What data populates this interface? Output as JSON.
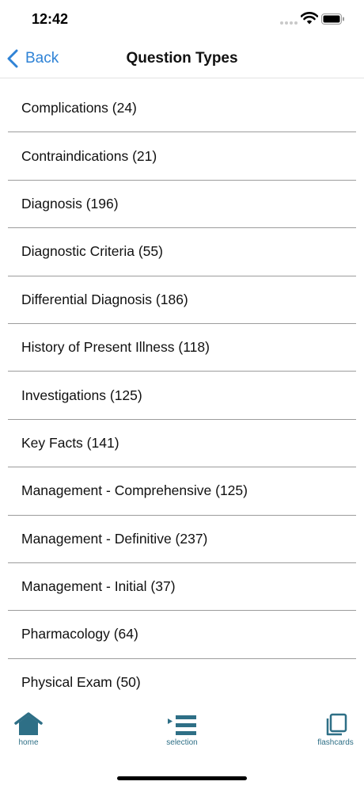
{
  "status_bar": {
    "time": "12:42",
    "signal_icon": "signal-dots-icon",
    "wifi_icon": "wifi-icon",
    "battery_icon": "battery-icon"
  },
  "nav": {
    "back_label": "Back",
    "back_icon": "chevron-left-icon",
    "title": "Question Types",
    "accent_color": "#2f83d6"
  },
  "list": {
    "items": [
      {
        "label": "Complications (24)"
      },
      {
        "label": "Contraindications (21)"
      },
      {
        "label": "Diagnosis (196)"
      },
      {
        "label": "Diagnostic Criteria (55)"
      },
      {
        "label": "Differential Diagnosis (186)"
      },
      {
        "label": "History of Present Illness (118)"
      },
      {
        "label": "Investigations (125)"
      },
      {
        "label": "Key Facts (141)"
      },
      {
        "label": "Management - Comprehensive (125)"
      },
      {
        "label": "Management - Definitive (237)"
      },
      {
        "label": "Management - Initial (37)"
      },
      {
        "label": "Pharmacology (64)"
      },
      {
        "label": "Physical Exam (50)"
      }
    ]
  },
  "tab_bar": {
    "tint_color": "#2e6f86",
    "home": {
      "label": "home",
      "icon": "home-icon"
    },
    "selection": {
      "label": "selection",
      "icon": "list-icon"
    },
    "flashcards": {
      "label": "flashcards",
      "icon": "flashcards-icon"
    }
  }
}
